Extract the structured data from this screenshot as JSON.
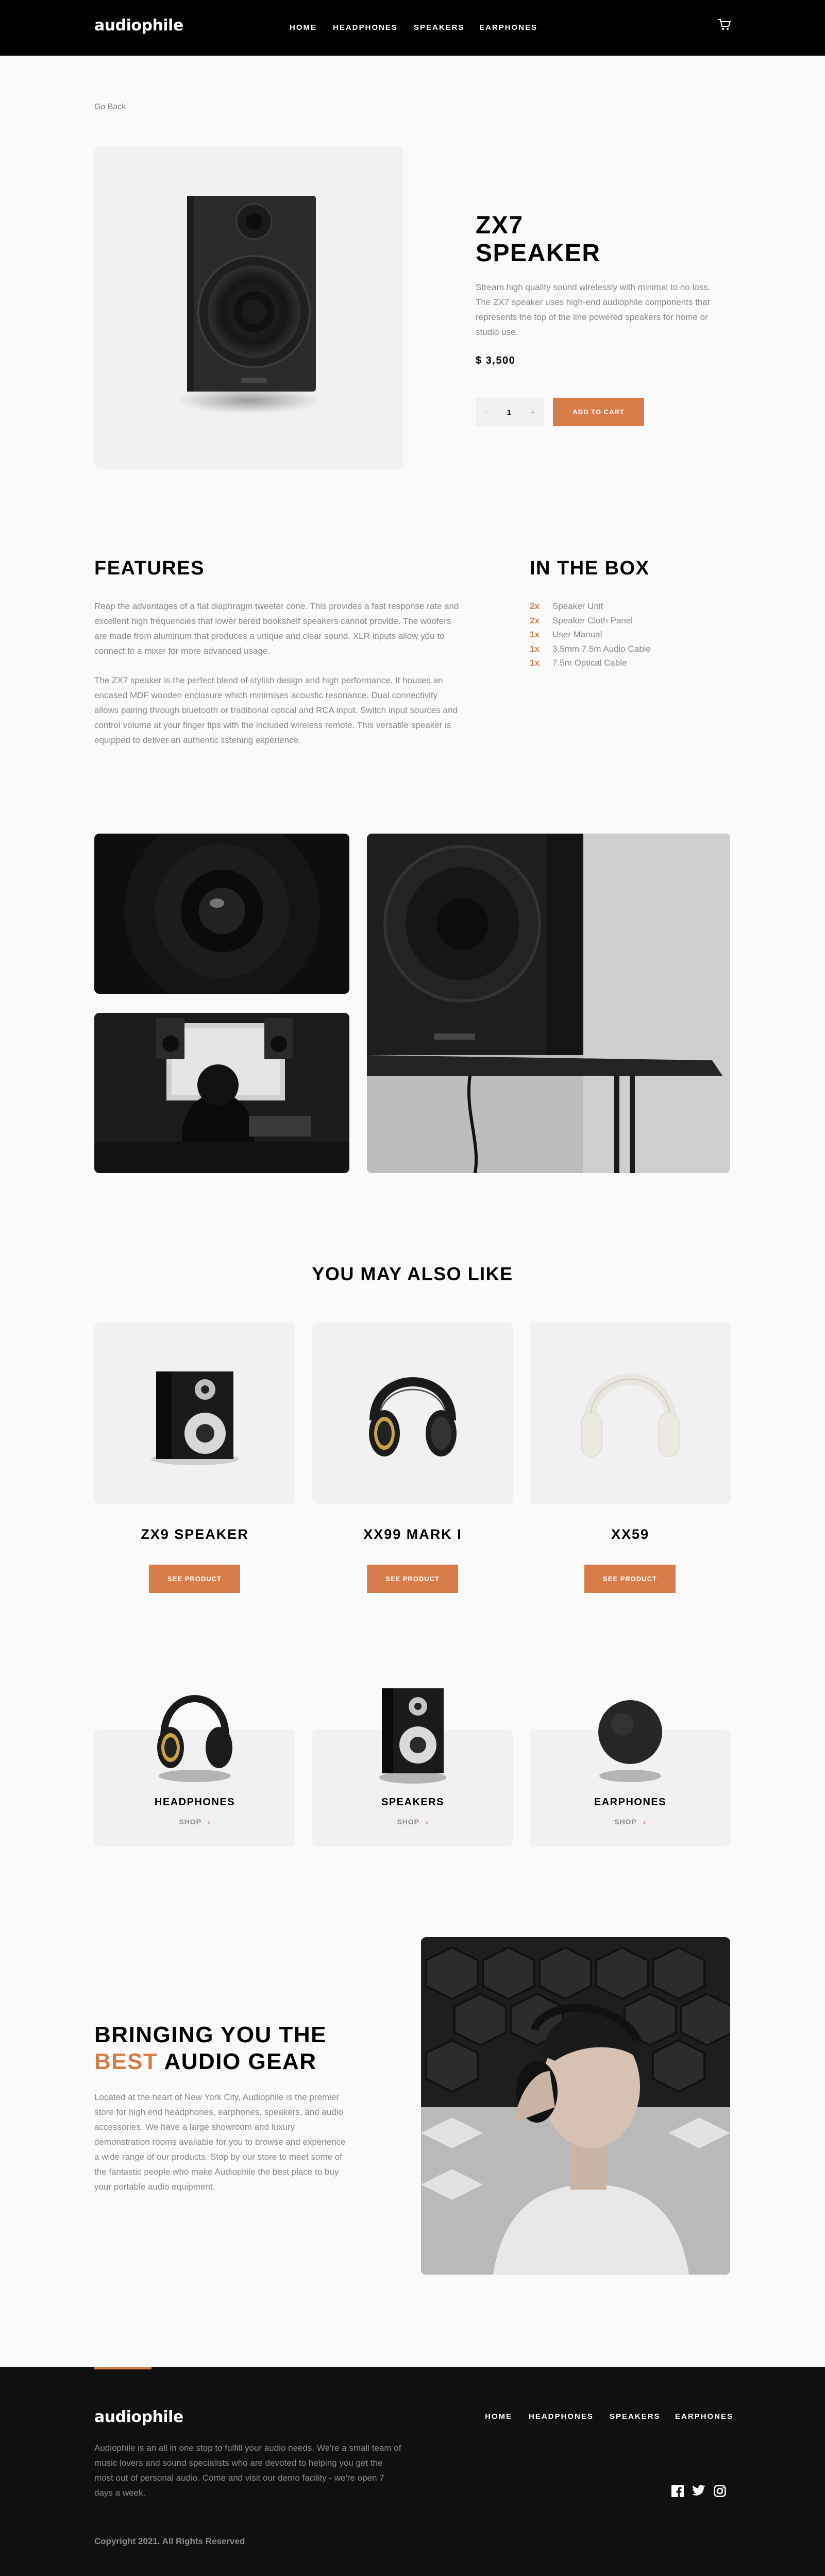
{
  "header": {
    "logo": "audiophile",
    "nav": [
      "HOME",
      "HEADPHONES",
      "SPEAKERS",
      "EARPHONES"
    ]
  },
  "go_back": "Go Back",
  "product": {
    "title_line1": "ZX7",
    "title_line2": "SPEAKER",
    "description": "Stream high quality sound wirelessly with minimal to no loss. The ZX7 speaker uses high-end audiophile components that represents the top of the line powered speakers for home or studio use.",
    "price": "$ 3,500",
    "qty_minus": "-",
    "qty_value": "1",
    "qty_plus": "+",
    "add_to_cart": "ADD TO CART"
  },
  "features": {
    "title": "FEATURES",
    "paragraph1": "Reap the advantages of a flat diaphragm tweeter cone. This provides a fast response rate and excellent high frequencies that lower tiered bookshelf speakers cannot provide. The woofers are made from aluminum that produces a unique and clear sound. XLR inputs allow you to connect to a mixer for more advanced usage.",
    "paragraph2": "The ZX7 speaker is the perfect blend of stylish design and high performance. It houses an encased MDF wooden enclosure which minimises acoustic resonance. Dual connectivity allows pairing through bluetooth or traditional optical and RCA input. Switch input sources and control volume at your finger tips with the included wireless remote. This versatile speaker is equipped to deliver an authentic listening experience."
  },
  "in_the_box": {
    "title": "IN THE BOX",
    "items": [
      {
        "qty": "2x",
        "name": "Speaker Unit"
      },
      {
        "qty": "2x",
        "name": "Speaker Cloth Panel"
      },
      {
        "qty": "1x",
        "name": "User Manual"
      },
      {
        "qty": "1x",
        "name": "3.5mm 7.5m Audio Cable"
      },
      {
        "qty": "1x",
        "name": "7.5m Optical Cable"
      }
    ]
  },
  "also_like": {
    "title": "YOU MAY ALSO LIKE",
    "items": [
      {
        "name": "ZX9 SPEAKER",
        "button": "SEE PRODUCT"
      },
      {
        "name": "XX99 MARK I",
        "button": "SEE PRODUCT"
      },
      {
        "name": "XX59",
        "button": "SEE PRODUCT"
      }
    ]
  },
  "categories": [
    {
      "name": "HEADPHONES",
      "shop": "SHOP"
    },
    {
      "name": "SPEAKERS",
      "shop": "SHOP"
    },
    {
      "name": "EARPHONES",
      "shop": "SHOP"
    }
  ],
  "about": {
    "title_line1": "BRINGING YOU THE",
    "title_accent": "BEST",
    "title_line2_rest": " AUDIO GEAR",
    "text": "Located at the heart of New York City, Audiophile is the premier store for high end headphones, earphones, speakers, and audio accessories. We have a large showroom and luxury demonstration rooms available for you to browse and experience a wide range of our products. Stop by our store to meet some of the fantastic people who make Audiophile the best place to buy your portable audio equipment."
  },
  "footer": {
    "logo": "audiophile",
    "nav": [
      "HOME",
      "HEADPHONES",
      "SPEAKERS",
      "EARPHONES"
    ],
    "text": "Audiophile is an all in one stop to fulfill your audio needs. We're a small team of music lovers and sound specialists who are devoted to helping you get the most out of personal audio. Come and visit our demo facility - we're open 7 days a week.",
    "copyright": "Copyright 2021. All Rights Reserved"
  },
  "colors": {
    "accent": "#d87d4a",
    "dark": "#101010",
    "card": "#f1f1f1",
    "muted": "#8a8a8a"
  }
}
